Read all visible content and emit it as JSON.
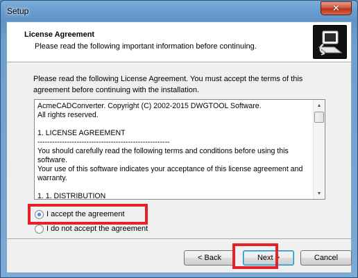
{
  "window": {
    "title": "Setup",
    "close_glyph": "✕"
  },
  "header": {
    "title": "License Agreement",
    "subtitle": "Please read the following important information before continuing.",
    "logo_icon": "installer-computer-icon"
  },
  "intro_text": "Please read the following License Agreement. You must accept the terms of this agreement before continuing with the installation.",
  "license": {
    "lines": [
      "AcmeCADConverter.  Copyright (C) 2002-2015 DWGTOOL Software.",
      "All rights reserved.",
      "",
      "1. LICENSE AGREEMENT",
      "------------------------------------------------------",
      "You should carefully read the following terms and conditions before using this software.",
      "Your use of this software indicates your acceptance of this license agreement and warranty.",
      "",
      "1. 1. DISTRIBUTION"
    ]
  },
  "options": {
    "accept_label": "I accept the agreement",
    "decline_label": "I do not accept the agreement",
    "selected": "accept"
  },
  "buttons": {
    "back": "< Back",
    "next": "Next >",
    "cancel": "Cancel"
  },
  "colors": {
    "highlight": "#e8202a"
  }
}
